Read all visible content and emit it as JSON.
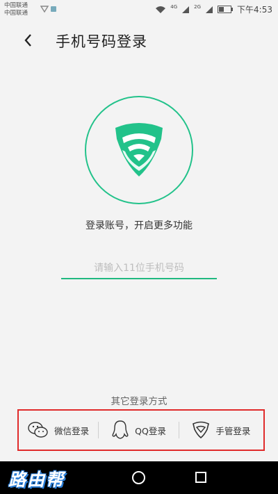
{
  "status_bar": {
    "carrier_1": "中国联通",
    "carrier_2": "中国联通",
    "signal_tags": [
      "4G",
      "2G"
    ],
    "time": "下午4:53"
  },
  "header": {
    "title": "手机号码登录"
  },
  "tagline": "登录账号，开启更多功能",
  "phone_input": {
    "placeholder": "请输入11位手机号码",
    "value": ""
  },
  "other_login": {
    "title": "其它登录方式",
    "options": [
      {
        "label": "微信登录",
        "icon": "wechat-icon"
      },
      {
        "label": "QQ登录",
        "icon": "qq-icon"
      },
      {
        "label": "手管登录",
        "icon": "shield-icon"
      }
    ]
  },
  "watermark": "路由帮",
  "colors": {
    "accent": "#22c28a",
    "highlight": "#e02a2a"
  }
}
